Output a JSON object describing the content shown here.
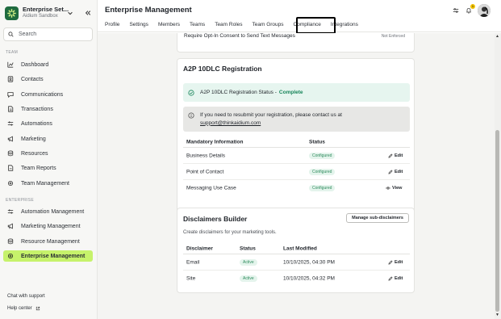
{
  "app": {
    "org_name": "Enterprise Set...",
    "org_sub": "Aidium Sandbox"
  },
  "search": {
    "placeholder": "Search"
  },
  "sidebar": {
    "team_label": "TEAM",
    "team_items": [
      {
        "label": "Dashboard",
        "icon": "chart-icon"
      },
      {
        "label": "Contacts",
        "icon": "contacts-icon"
      },
      {
        "label": "Communications",
        "icon": "chat-icon"
      },
      {
        "label": "Transactions",
        "icon": "document-icon"
      },
      {
        "label": "Automations",
        "icon": "sliders-icon"
      },
      {
        "label": "Marketing",
        "icon": "megaphone-icon"
      },
      {
        "label": "Resources",
        "icon": "database-icon"
      },
      {
        "label": "Team Reports",
        "icon": "report-icon"
      },
      {
        "label": "Team Management",
        "icon": "gear-icon"
      }
    ],
    "enterprise_label": "ENTERPRISE",
    "enterprise_items": [
      {
        "label": "Automation Management",
        "icon": "sliders-icon"
      },
      {
        "label": "Marketing Management",
        "icon": "megaphone-icon"
      },
      {
        "label": "Resource Management",
        "icon": "database-icon"
      },
      {
        "label": "Enterprise Management",
        "icon": "gear-icon",
        "active": true
      }
    ],
    "chat_support": "Chat with support",
    "help_center": "Help center"
  },
  "header": {
    "title": "Enterprise Management",
    "tabs": [
      "Profile",
      "Settings",
      "Members",
      "Teams",
      "Team Roles",
      "Team Groups",
      "Compliance",
      "Integrations"
    ],
    "active_tab": "Compliance",
    "notification_count": "1"
  },
  "opt_in": {
    "label": "Require Opt-In Consent to Send Text Messages",
    "status": "Not Enforced"
  },
  "a2p": {
    "title": "A2P 10DLC Registration",
    "status_label": "A2P 10DLC Registration Status -",
    "status_value": "Complete",
    "info_text": "If you need to resubmit your registration, please contact us at",
    "info_email": "support@thinkaidium.com",
    "columns": [
      "Mandatory Information",
      "Status"
    ],
    "rows": [
      {
        "name": "Business Details",
        "status": "Configured",
        "action": "Edit"
      },
      {
        "name": "Point of Contact",
        "status": "Configured",
        "action": "Edit"
      },
      {
        "name": "Messaging Use Case",
        "status": "Configured",
        "action": "View"
      }
    ]
  },
  "disclaimers": {
    "title": "Disclaimers Builder",
    "button": "Manage sub-disclaimers",
    "subtitle": "Create disclaimers for your marketing tools.",
    "columns": [
      "Disclaimer",
      "Status",
      "Last Modified"
    ],
    "rows": [
      {
        "name": "Email",
        "status": "Active",
        "modified": "10/10/2025, 04:30 PM",
        "action": "Edit"
      },
      {
        "name": "Site",
        "status": "Active",
        "modified": "10/10/2025, 04:32 PM",
        "action": "Edit"
      }
    ]
  },
  "colors": {
    "active_nav": "#c6f26b",
    "brand": "#1f6b3f",
    "complete": "#17855a"
  }
}
